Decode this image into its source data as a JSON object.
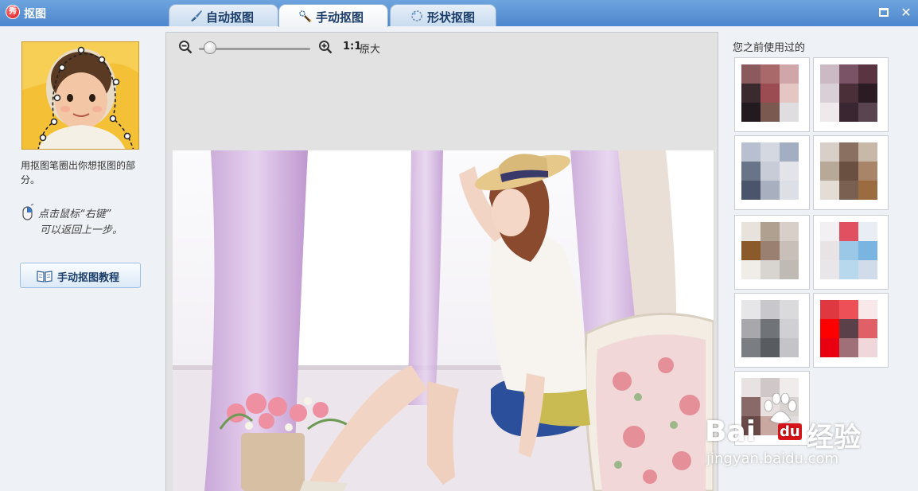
{
  "window": {
    "title": "抠图",
    "app_icon_char": "秀",
    "maximize_label": "",
    "close_label": "✕"
  },
  "tabs": [
    {
      "label": "自动抠图",
      "icon": "brush-icon",
      "active": false
    },
    {
      "label": "手动抠图",
      "icon": "pen-tool-icon",
      "active": true
    },
    {
      "label": "形状抠图",
      "icon": "shape-icon",
      "active": false
    }
  ],
  "left_panel": {
    "help_text": "用抠图笔圈出你想抠图的部分。",
    "hint_line1": "点击鼠标“右键”",
    "hint_line2": "可以返回上一步。",
    "tutorial_button": "手动抠图教程"
  },
  "zoom": {
    "ratio": "1:1",
    "ratio_label": "原大",
    "level": 0.1
  },
  "history": {
    "title": "您之前使用过的"
  },
  "watermark": {
    "brand": "Bai",
    "brand2": "du",
    "product": "经验",
    "url": "jingyan.baidu.com"
  },
  "colors": {
    "titlebar": "#4c86cc",
    "tab_text": "#1b3d69",
    "accent_red": "#d8141a"
  }
}
